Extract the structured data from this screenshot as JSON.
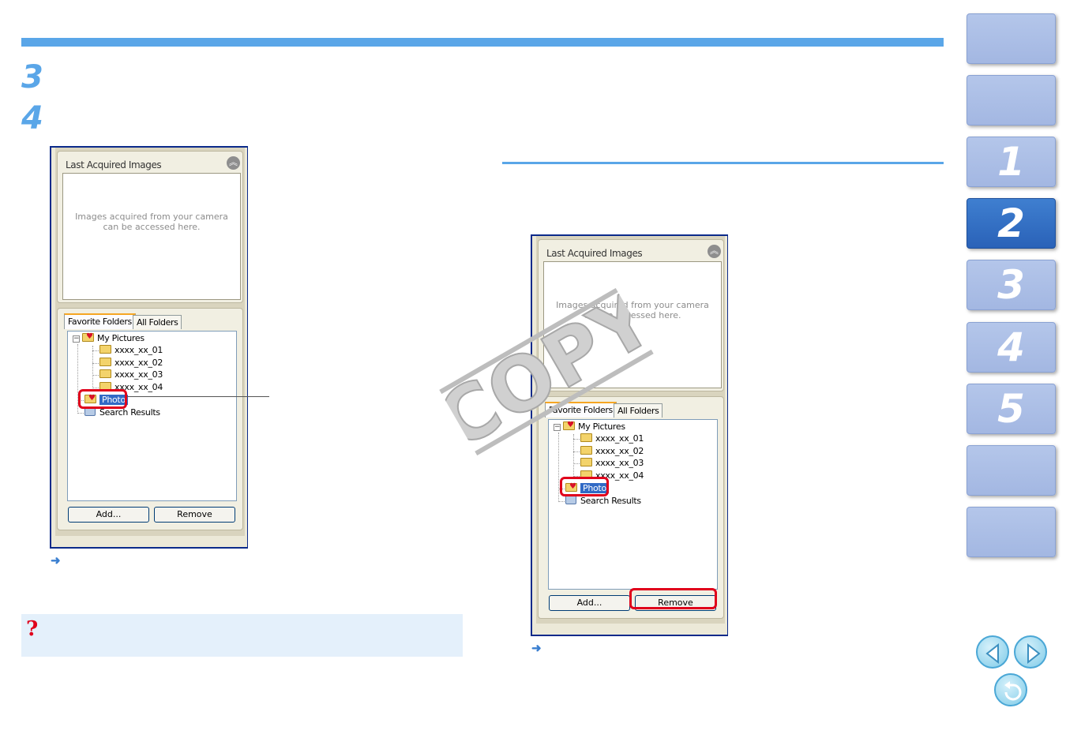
{
  "headings": {
    "step3": "3",
    "step4": "4"
  },
  "panel": {
    "section_title": "Last Acquired Images",
    "collapse_glyph": "︽",
    "preview_text": "Images acquired from your camera\ncan be accessed here.",
    "tabs": [
      "Favorite Folders",
      "All Folders"
    ],
    "tree": {
      "root": "My Pictures",
      "children": [
        "xxxx_xx_01",
        "xxxx_xx_02",
        "xxxx_xx_03",
        "xxxx_xx_04"
      ],
      "selected": "Photo",
      "search": "Search Results"
    },
    "add_label": "Add...",
    "remove_label": "Remove"
  },
  "arrow_glyph": "➜",
  "watermark": "COPY",
  "note_glyph": "?",
  "nav": {
    "chapters": [
      "",
      "",
      "1",
      "2",
      "3",
      "4",
      "5",
      "",
      ""
    ],
    "active": "2",
    "prev_icon": "prev-page-icon",
    "next_icon": "next-page-icon",
    "back_icon": "return-icon"
  },
  "colors": {
    "accent": "#5aa6e8",
    "highlight": "#e0001b",
    "note_bg": "#e4f0fb",
    "selection": "#316ac5"
  }
}
